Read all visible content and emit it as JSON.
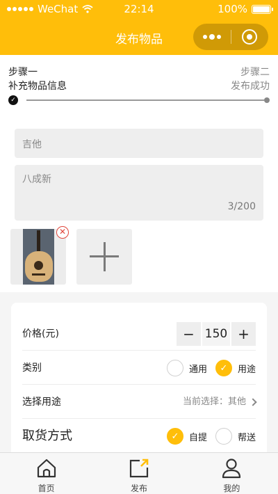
{
  "status_bar": {
    "carrier": "WeChat",
    "time": "22:14",
    "battery": "100%"
  },
  "nav": {
    "title": "发布物品"
  },
  "steps": {
    "left_title": "步骤一",
    "left_desc": "补充物品信息",
    "right_title": "步骤二",
    "right_desc": "发布成功"
  },
  "form": {
    "name_placeholder": "吉他",
    "desc_placeholder": "八成新",
    "desc_count": "3/200"
  },
  "details": {
    "price_label": "价格(元)",
    "price_value": "150",
    "minus": "−",
    "plus": "+",
    "category_label": "类别",
    "category_options": [
      {
        "label": "通用",
        "selected": false
      },
      {
        "label": "用途",
        "selected": true
      }
    ],
    "purpose_label": "选择用途",
    "purpose_current": "当前选择：其他",
    "pickup_label": "取货方式",
    "pickup_options": [
      {
        "label": "自提",
        "selected": true
      },
      {
        "label": "帮送",
        "selected": false
      }
    ]
  },
  "tabbar": {
    "items": [
      {
        "label": "首页",
        "icon": "home-icon"
      },
      {
        "label": "发布",
        "icon": "publish-icon"
      },
      {
        "label": "我的",
        "icon": "user-icon"
      }
    ]
  },
  "colors": {
    "accent": "#FFBE0A",
    "remove": "#E0453A"
  }
}
